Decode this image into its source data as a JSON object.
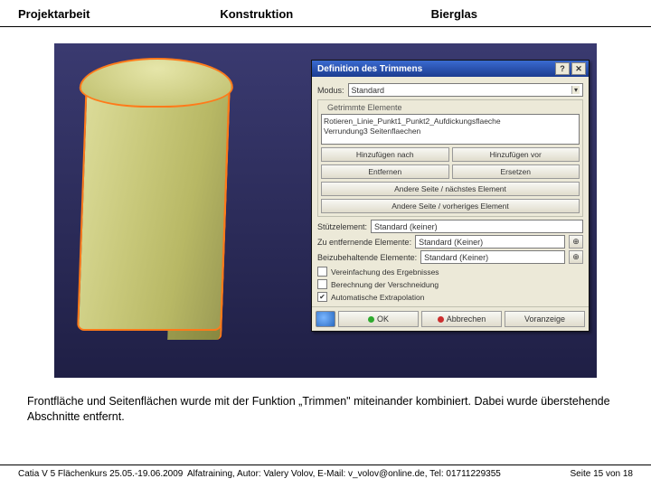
{
  "header": {
    "left": "Projektarbeit",
    "mid": "Konstruktion",
    "right": "Bierglas"
  },
  "dialog": {
    "title": "Definition des Trimmens",
    "mode_label": "Modus:",
    "mode_value": "Standard",
    "group_elements": "Getrimmte Elemente",
    "list_line1": "Rotieren_Linie_Punkt1_Punkt2_Aufdickungsflaeche",
    "list_line2": "Verrundung3 Seitenflaechen",
    "btn_add_after": "Hinzufügen nach",
    "btn_add_before": "Hinzufügen vor",
    "btn_remove": "Entfernen",
    "btn_replace": "Ersetzen",
    "btn_other_next": "Andere Seite / nächstes Element",
    "btn_other_prev": "Andere Seite / vorheriges Element",
    "support_label": "Stützelement:",
    "support_value": "Standard (keiner)",
    "remove_label": "Zu entfernende Elemente:",
    "remove_value": "Standard (Keiner)",
    "keep_label": "Beizubehaltende Elemente:",
    "keep_value": "Standard (Keiner)",
    "chk_simplify": "Vereinfachung des Ergebnisses",
    "chk_intersect": "Berechnung der Verschneidung",
    "chk_extrapolate": "Automatische Extrapolation",
    "ok": "OK",
    "cancel": "Abbrechen",
    "preview": "Voranzeige"
  },
  "caption": "Frontfläche und Seitenflächen wurde mit der Funktion „Trimmen\" miteinander kombiniert. Dabei wurde überstehende Abschnitte entfernt.",
  "footer": {
    "left": "Catia V 5 Flächenkurs 25.05.-19.06.2009",
    "mid": "Alfatraining, Autor: Valery Volov, E-Mail: v_volov@online.de, Tel: 01711229355",
    "right": "Seite 15 von 18"
  }
}
